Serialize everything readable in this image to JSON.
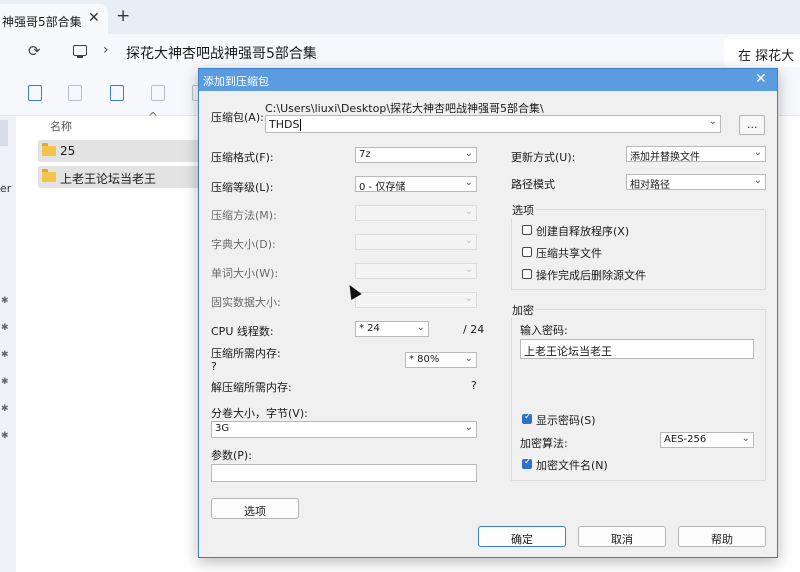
{
  "explorer": {
    "tab_title": "神强哥5部合集",
    "tab_close": "✕",
    "tab_new": "+",
    "refresh_icon": "⟳",
    "breadcrumb_sep": "›",
    "breadcrumb_folder": "探花大神杏吧战神强哥5部合集",
    "search_placeholder": "在 探花大",
    "column_name": "名称",
    "sort_caret": "^",
    "rows": [
      "25",
      "上老王论坛当老王"
    ],
    "side_fragment": "er",
    "pin_glyph": "✱"
  },
  "dialog": {
    "title": "添加到压缩包",
    "close": "✕",
    "archive_label": "压缩包(A):",
    "archive_path": "C:\\Users\\liuxi\\Desktop\\探花大神杏吧战神强哥5部合集\\",
    "archive_name": "THDS",
    "browse_label": "...",
    "format_label": "压缩格式(F):",
    "format_value": "7z",
    "level_label": "压缩等级(L):",
    "level_value": "0 - 仅存储",
    "method_label": "压缩方法(M):",
    "dict_label": "字典大小(D):",
    "word_label": "单词大小(W):",
    "solid_label": "固实数据大小:",
    "threads_label": "CPU 线程数:",
    "threads_value": "* 24",
    "threads_max": "/ 24",
    "mem_comp_label": "压缩所需内存:",
    "mem_comp_value": "?",
    "mem_percent": "* 80%",
    "mem_decomp_label": "解压缩所需内存:",
    "mem_decomp_value": "?",
    "volume_label": "分卷大小，字节(V):",
    "volume_value": "3G",
    "params_label": "参数(P):",
    "params_value": "",
    "options_button": "选项",
    "update_label": "更新方式(U):",
    "update_value": "添加并替换文件",
    "path_label": "路径模式",
    "path_value": "相对路径",
    "options_group": "选项",
    "opt_sfx": "创建自释放程序(X)",
    "opt_shared": "压缩共享文件",
    "opt_delete": "操作完成后删除源文件",
    "encrypt_group": "加密",
    "password_label": "输入密码:",
    "password_value": "上老王论坛当老王",
    "show_password": "显示密码(S)",
    "enc_method_label": "加密算法:",
    "enc_method_value": "AES-256",
    "encrypt_names": "加密文件名(N)",
    "ok": "确定",
    "cancel": "取消",
    "help": "帮助",
    "dropdown_arrow": "⌄"
  },
  "colors": {
    "title_bar": "#5b9be0",
    "accent": "#2f70c9",
    "folder": "#f4c34a"
  }
}
